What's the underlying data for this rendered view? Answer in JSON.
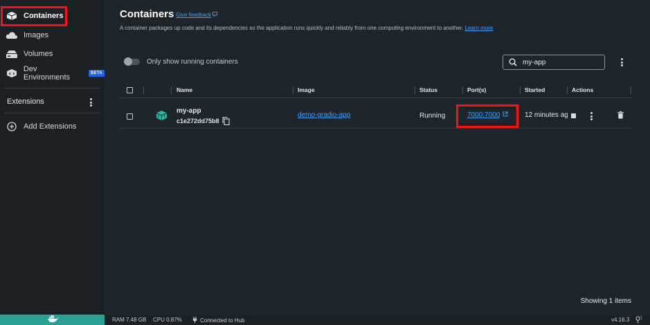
{
  "sidebar": {
    "items": [
      {
        "label": "Containers",
        "icon": "containers-icon"
      },
      {
        "label": "Images",
        "icon": "cloud-icon"
      },
      {
        "label": "Volumes",
        "icon": "volumes-icon"
      },
      {
        "label": "Dev Environments",
        "icon": "dev-environments-icon",
        "badge": "BETA"
      }
    ],
    "extensions_title": "Extensions",
    "add_extensions": "Add Extensions"
  },
  "header": {
    "title": "Containers",
    "feedback": "Give feedback",
    "description": "A container packages up code and its dependencies so the application runs quickly and reliably from one computing environment to another.",
    "learn_more": "Learn more"
  },
  "filters": {
    "toggle_label": "Only show running containers",
    "search_value": "my-app"
  },
  "table": {
    "columns": [
      "Name",
      "Image",
      "Status",
      "Port(s)",
      "Started",
      "Actions"
    ],
    "rows": [
      {
        "name": "my-app",
        "id": "c1e272dd75b8",
        "image": "demo-gradio-app",
        "status": "Running",
        "ports": "7000:7000",
        "started": "12 minutes ag"
      }
    ]
  },
  "footer": {
    "showing": "Showing 1 items"
  },
  "statusbar": {
    "ram": "RAM 7.48 GB",
    "cpu": "CPU 0.87%",
    "hub": "Connected to Hub",
    "version": "v4.16.3"
  },
  "colors": {
    "accent_link": "#3ea2ff",
    "highlight": "#ff1010",
    "status_bar_green": "#2aa193",
    "container_icon": "#2bb5a2"
  }
}
